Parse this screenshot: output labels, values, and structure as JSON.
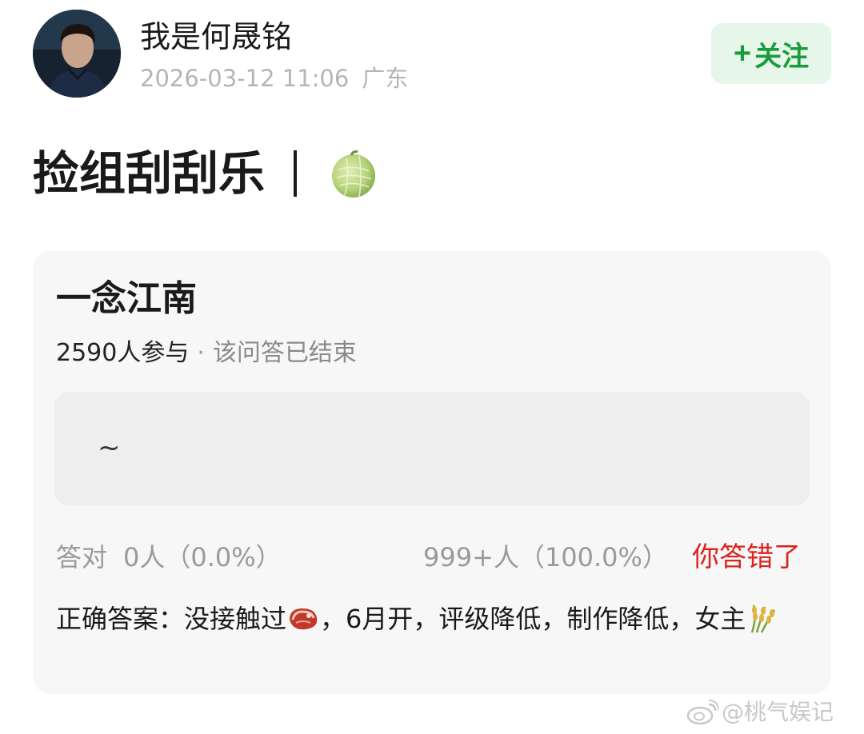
{
  "author": {
    "name": "我是何晟铭",
    "timestamp": "2026-03-12 11:06",
    "location": "广东",
    "follow_label": "关注",
    "follow_plus": "+"
  },
  "post": {
    "title": "捡组刮刮乐",
    "title_icon": "melon-icon"
  },
  "quiz": {
    "title": "一念江南",
    "participants": "2590人参与",
    "dot": "·",
    "status": "该问答已结束",
    "option_text": "~",
    "correct_label": "答对",
    "correct_result": "0人（0.0%）",
    "other_result": "999+人（100.0%）",
    "wrong_notice": "你答错了",
    "answer_part1": "正确答案：没接触过",
    "answer_icon1": "meat-icon",
    "answer_part2": "，6月开，评级降低，制作降低，女主",
    "answer_icon2": "rice-icon"
  },
  "watermark": {
    "text": "@桃气娱记",
    "icon": "weibo-icon"
  },
  "colors": {
    "follow_green": "#1b9c3c",
    "follow_bg": "#e6f6e8",
    "wrong_red": "#d8251e",
    "card_bg": "#f7f7f7",
    "option_bg": "#eeeeee",
    "muted_text": "#9a9a9a"
  }
}
